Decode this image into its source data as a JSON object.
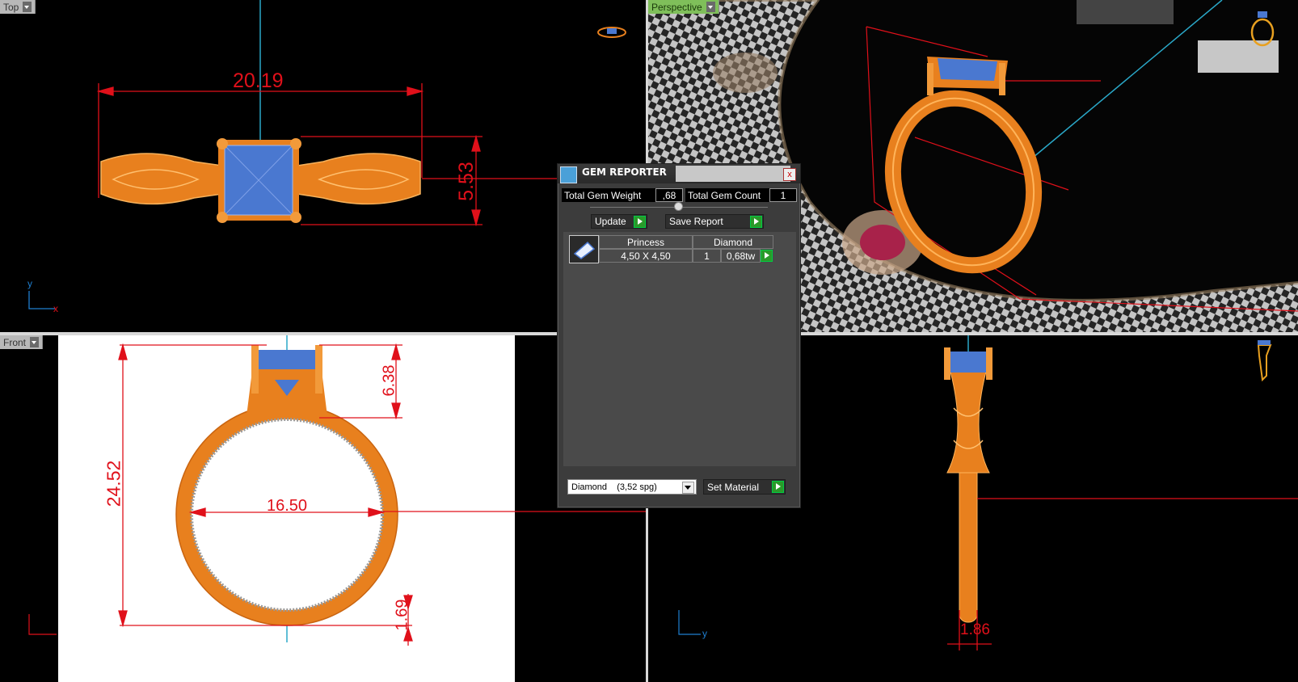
{
  "viewports": {
    "top": {
      "label": "Top",
      "dim_width": "20.19",
      "dim_height": "5.53"
    },
    "perspective": {
      "label": "Perspective"
    },
    "front": {
      "label": "Front",
      "dim_height": "24.52",
      "dim_inner": "16.50",
      "dim_head": "6.38",
      "dim_shank": "1.69"
    },
    "right": {
      "dim_shank": "1.86"
    }
  },
  "axes": {
    "x": "x",
    "y": "y"
  },
  "gem_reporter": {
    "title": "GEM REPORTER",
    "close": "x",
    "total_weight_label": "Total Gem Weight",
    "total_weight_value": ",68",
    "total_count_label": "Total Gem Count",
    "total_count_value": "1",
    "update_label": "Update",
    "save_report_label": "Save Report",
    "gem_row": {
      "shape": "Princess",
      "material": "Diamond",
      "size": "4,50 X 4,50",
      "count": "1",
      "weight": "0,68tw"
    },
    "material_select": "Diamond    (3,52 spg)",
    "set_material_label": "Set Material"
  },
  "colors": {
    "metal": "#e8801e",
    "gem": "#4a78d0",
    "dimension": "#e0101a",
    "axis_line": "#2aa8c8"
  }
}
